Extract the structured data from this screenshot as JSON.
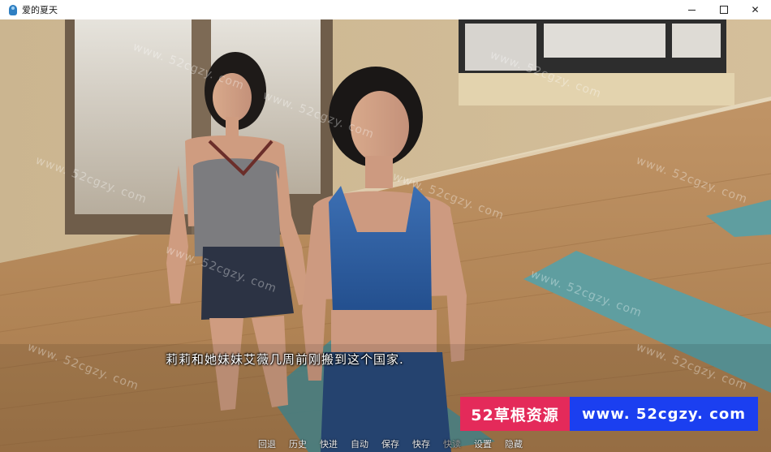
{
  "window": {
    "title": "爱的夏天",
    "controls": {
      "minimize": "—",
      "maximize": "□",
      "close": "✕"
    }
  },
  "dialogue": {
    "text": "莉莉和她妹妹艾薇几周前刚搬到这个国家."
  },
  "banner": {
    "left_text": "52草根资源",
    "right_text": "www. 52cgzy. com"
  },
  "watermark": "www. 52cgzy. com",
  "quick_menu": [
    {
      "label": "回退"
    },
    {
      "label": "历史"
    },
    {
      "label": "快进"
    },
    {
      "label": "自动"
    },
    {
      "label": "保存"
    },
    {
      "label": "快存"
    },
    {
      "label": "快读"
    },
    {
      "label": "设置"
    },
    {
      "label": "隐藏"
    }
  ],
  "colors": {
    "banner_left": "#e42a5a",
    "banner_right": "#1b3ff0",
    "floor": "#b78a5a",
    "mat": "#5f9ea0"
  }
}
